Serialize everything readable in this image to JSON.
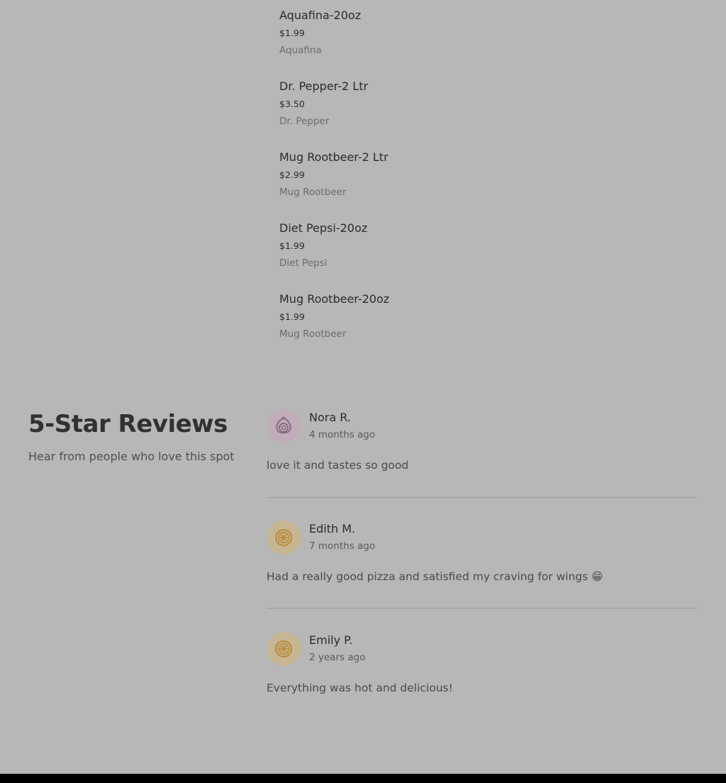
{
  "menu": {
    "items": [
      {
        "name": "Aquafina-20oz",
        "price": "$1.99",
        "description": "Aquafina"
      },
      {
        "name": "Dr. Pepper-2 Ltr",
        "price": "$3.50",
        "description": "Dr. Pepper"
      },
      {
        "name": "Mug Rootbeer-2 Ltr",
        "price": "$2.99",
        "description": "Mug Rootbeer"
      },
      {
        "name": "Diet Pepsi-20oz",
        "price": "$1.99",
        "description": "Diet Pepsi"
      },
      {
        "name": "Mug Rootbeer-20oz",
        "price": "$1.99",
        "description": "Mug Rootbeer"
      }
    ]
  },
  "reviews_section": {
    "title": "5-Star Reviews",
    "subtitle": "Hear from people who love this spot",
    "reviews": [
      {
        "name": "Nora R.",
        "date": "4 months ago",
        "text": "love it and tastes so good",
        "avatar_icon": "onion-icon",
        "avatar_color": "#c1adba"
      },
      {
        "name": "Edith M.",
        "date": "7 months ago",
        "text": "Had a really good pizza and satisfied my craving for wings 😁",
        "avatar_icon": "orange-slice-icon",
        "avatar_color": "#c7b692"
      },
      {
        "name": "Emily P.",
        "date": "2 years ago",
        "text": "Everything was hot and delicious!",
        "avatar_icon": "orange-slice-icon",
        "avatar_color": "#c7b692"
      }
    ]
  },
  "colors": {
    "page_background": "#b7b7b7",
    "footer": "#000000"
  }
}
